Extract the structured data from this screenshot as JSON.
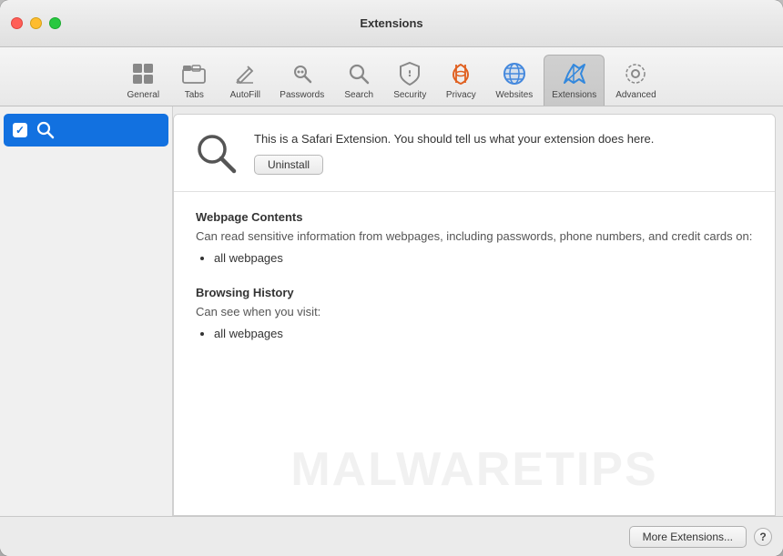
{
  "window": {
    "title": "Extensions"
  },
  "titlebar": {
    "title": "Extensions",
    "buttons": {
      "close": "close",
      "minimize": "minimize",
      "maximize": "maximize"
    }
  },
  "toolbar": {
    "items": [
      {
        "id": "general",
        "label": "General",
        "icon": "general-icon"
      },
      {
        "id": "tabs",
        "label": "Tabs",
        "icon": "tabs-icon"
      },
      {
        "id": "autofill",
        "label": "AutoFill",
        "icon": "autofill-icon"
      },
      {
        "id": "passwords",
        "label": "Passwords",
        "icon": "passwords-icon"
      },
      {
        "id": "search",
        "label": "Search",
        "icon": "search-icon"
      },
      {
        "id": "security",
        "label": "Security",
        "icon": "security-icon"
      },
      {
        "id": "privacy",
        "label": "Privacy",
        "icon": "privacy-icon"
      },
      {
        "id": "websites",
        "label": "Websites",
        "icon": "websites-icon"
      },
      {
        "id": "extensions",
        "label": "Extensions",
        "icon": "extensions-icon"
      },
      {
        "id": "advanced",
        "label": "Advanced",
        "icon": "advanced-icon"
      }
    ],
    "active": "extensions"
  },
  "sidebar": {
    "items": [
      {
        "id": "search-ext",
        "label": "",
        "checked": true,
        "selected": true
      }
    ]
  },
  "extension": {
    "description": "This is a Safari Extension. You should tell us what your extension does here.",
    "uninstall_label": "Uninstall",
    "permissions": {
      "webpage_contents": {
        "title": "Webpage Contents",
        "description": "Can read sensitive information from webpages, including passwords, phone numbers, and credit cards on:",
        "items": [
          "all webpages"
        ]
      },
      "browsing_history": {
        "title": "Browsing History",
        "description": "Can see when you visit:",
        "items": [
          "all webpages"
        ]
      }
    }
  },
  "footer": {
    "more_extensions_label": "More Extensions...",
    "help_label": "?"
  },
  "watermark": {
    "text": "MALWARETIPS"
  },
  "colors": {
    "accent": "#1271e0",
    "selected_bg": "#1271e0",
    "window_bg": "#ebebeb"
  }
}
